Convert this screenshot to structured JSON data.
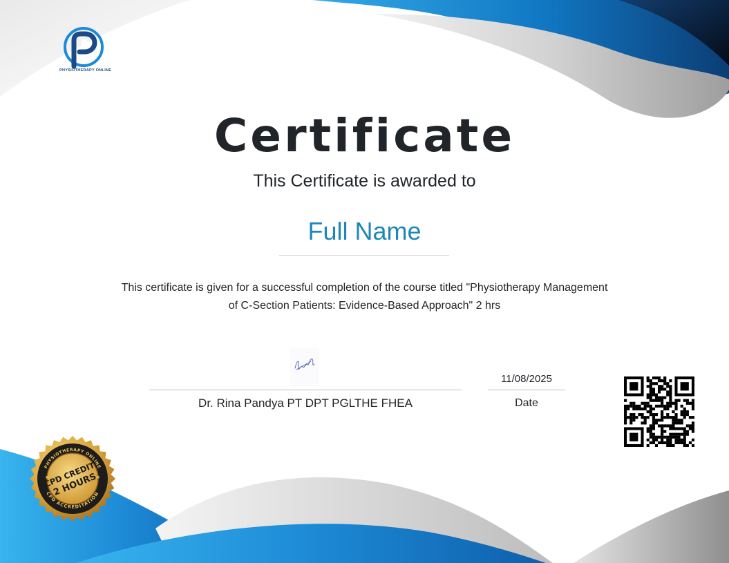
{
  "logo": {
    "brand": "PHYSIOTHERAPY ONLINE",
    "icon": "p-circle-logo-icon"
  },
  "certificate": {
    "title": "Certificate",
    "subtitle": "This Certificate is awarded to",
    "recipient_name": "Full Name",
    "description_line1": "This certificate is given for a successful completion of the course titled \"Physiotherapy Management",
    "description_line2": "of C-Section Patients: Evidence-Based Approach\" 2 hrs"
  },
  "signature": {
    "name": "Dr. Rina Pandya PT DPT PGLTHE FHEA",
    "icon": "signature-icon"
  },
  "date": {
    "value": "11/08/2025",
    "label": "Date"
  },
  "badge": {
    "arc_top": "PHYSIOTHERAPY ONLINE",
    "line1": "CPD CREDIT:",
    "line2": "2 HOURS",
    "arc_bottom": "CPD ACCREDITATION",
    "icon": "cpd-badge-icon"
  },
  "qr": {
    "icon": "qr-code-icon"
  },
  "colors": {
    "accent": "#1f86b8",
    "wave_blue": "#1a8fd6",
    "wave_dark": "#0b3f7a",
    "wave_gray": "#c4c4c4",
    "text": "#212529",
    "gold": "#d9a43a"
  }
}
